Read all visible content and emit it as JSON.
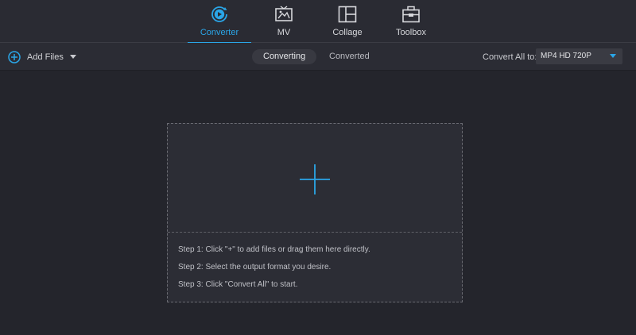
{
  "nav": {
    "tabs": [
      {
        "label": "Converter",
        "icon": "converter-icon",
        "active": true
      },
      {
        "label": "MV",
        "icon": "mv-icon",
        "active": false
      },
      {
        "label": "Collage",
        "icon": "collage-icon",
        "active": false
      },
      {
        "label": "Toolbox",
        "icon": "toolbox-icon",
        "active": false
      }
    ]
  },
  "toolbar": {
    "add_files_label": "Add Files",
    "segments": {
      "converting": "Converting",
      "converted": "Converted"
    },
    "convert_all_label": "Convert All to:",
    "format_value": "MP4 HD 720P"
  },
  "dropzone": {
    "steps": [
      "Step 1: Click \"+\" to add files or drag them here directly.",
      "Step 2: Select the output format you desire.",
      "Step 3: Click \"Convert All\" to start."
    ]
  },
  "colors": {
    "accent": "#2aa6e8",
    "background": "#24252c",
    "panel": "#2c2d35"
  }
}
